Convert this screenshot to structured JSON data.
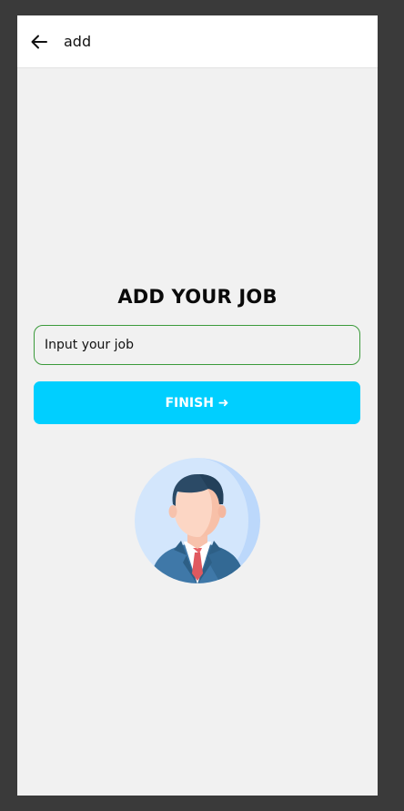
{
  "appbar": {
    "title": "add",
    "back_icon": "arrow-left-icon"
  },
  "main": {
    "heading": "ADD YOUR JOB",
    "job_input": {
      "placeholder": "Input your job",
      "value": ""
    },
    "finish_button": {
      "label": "FINISH ➜"
    },
    "avatar_icon": "businessman-avatar-icon"
  },
  "colors": {
    "accent": "#00cfff",
    "input_border": "#3b9a3b",
    "background": "#f1f1f1"
  }
}
